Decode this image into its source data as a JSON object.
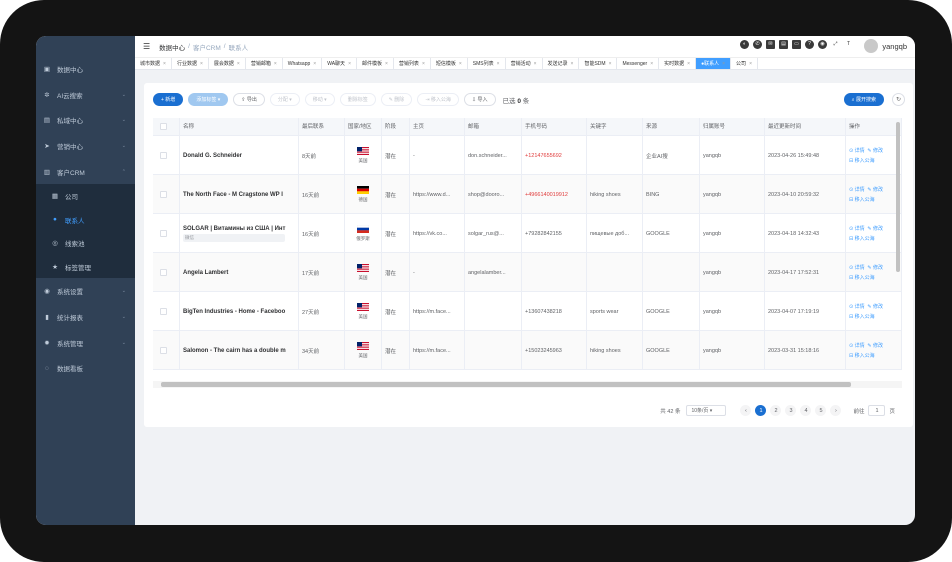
{
  "breadcrumb": [
    "数据中心",
    "客户CRM",
    "联系人"
  ],
  "user": {
    "name": "yangqb"
  },
  "sidebar": {
    "items": [
      {
        "label": "数据中心",
        "icon": "monitor-icon",
        "glyph": "▣"
      },
      {
        "label": "AI云搜索",
        "icon": "gear-icon",
        "glyph": "✲"
      },
      {
        "label": "私域中心",
        "icon": "database-icon",
        "glyph": "▤"
      },
      {
        "label": "营销中心",
        "icon": "send-icon",
        "glyph": "➤"
      },
      {
        "label": "客户CRM",
        "icon": "building-icon",
        "glyph": "▥"
      }
    ],
    "sub": [
      {
        "label": "公司",
        "icon": "company-icon",
        "glyph": "▦"
      },
      {
        "label": "联系人",
        "icon": "user-icon",
        "glyph": "●"
      },
      {
        "label": "线索池",
        "icon": "clue-icon",
        "glyph": "◎"
      },
      {
        "label": "标签管理",
        "icon": "star-icon",
        "glyph": "★"
      }
    ],
    "items2": [
      {
        "label": "系统设置",
        "icon": "globe-icon",
        "glyph": "◉"
      },
      {
        "label": "统计报表",
        "icon": "chart-icon",
        "glyph": "▮"
      },
      {
        "label": "系统管理",
        "icon": "cog-icon",
        "glyph": "✹"
      },
      {
        "label": "数据看板",
        "icon": "dashboard-icon",
        "glyph": "◌"
      }
    ]
  },
  "tabs": [
    "城市数据",
    "行业数据",
    "展会数据",
    "营销邮箱",
    "Whatsapp",
    "WA聊天",
    "邮件模板",
    "营销列表",
    "短信模板",
    "SMS列表",
    "营销活动",
    "发送记录",
    "智能SDM",
    "Messenger",
    "实时数据",
    "联系人",
    "公司"
  ],
  "toolbar": {
    "add": "+ 新增",
    "tag": "添加标签",
    "export": "导出",
    "assign": "分配",
    "move": "移动",
    "remove_tag": "删除标签",
    "delete": "删除",
    "move_pool": "移入公海",
    "import": "导入",
    "selected_prefix": "已选",
    "selected_count": "0",
    "selected_suffix": "条",
    "expand": "展开搜索"
  },
  "columns": [
    "名称",
    "最后联系",
    "国家/地区",
    "阶段",
    "主页",
    "邮箱",
    "手机号码",
    "关键字",
    "来源",
    "归属账号",
    "最近更新时间",
    "操作"
  ],
  "rows": [
    {
      "name": "Donald G. Schneider",
      "tag": "",
      "last": "8天前",
      "country": "美国",
      "flag": "us",
      "stage": "潜在",
      "home": "-",
      "email": "don.schneider...",
      "phone": "+12147655692",
      "phone_red": true,
      "keyword": "",
      "source": "企业AI搜",
      "owner": "yangqb",
      "updated": "2023-04-26 15:49:48"
    },
    {
      "name": "The North Face - M Cragstone WP I",
      "tag": "",
      "last": "16天前",
      "country": "德国",
      "flag": "de",
      "stage": "潜在",
      "home": "https://www.d...",
      "email": "shop@dooro...",
      "phone": "+4966140019912",
      "phone_red": true,
      "keyword": "hiking shoes",
      "source": "BING",
      "owner": "yangqb",
      "updated": "2023-04-10 20:59:32"
    },
    {
      "name": "SOLGAR | Витамины из США | Инт",
      "tag": "微信",
      "last": "16天前",
      "country": "俄罗斯",
      "flag": "ru",
      "stage": "潜在",
      "home": "https://vk.co...",
      "email": "solgar_rus@...",
      "phone": "+79282842155",
      "phone_red": false,
      "keyword": "пищевые доб...",
      "source": "GOOGLE",
      "owner": "yangqb",
      "updated": "2023-04-18 14:32:43"
    },
    {
      "name": "Angela Lambert",
      "tag": "",
      "last": "17天前",
      "country": "美国",
      "flag": "us",
      "stage": "潜在",
      "home": "-",
      "email": "angelalamber...",
      "phone": "",
      "phone_red": false,
      "keyword": "",
      "source": "",
      "owner": "yangqb",
      "updated": "2023-04-17 17:52:31"
    },
    {
      "name": "BigTen Industries - Home - Faceboo",
      "tag": "",
      "last": "27天前",
      "country": "美国",
      "flag": "us",
      "stage": "潜在",
      "home": "https://m.face...",
      "email": "",
      "phone": "+13607438218",
      "phone_red": false,
      "keyword": "sports wear",
      "source": "GOOGLE",
      "owner": "yangqb",
      "updated": "2023-04-07 17:19:19"
    },
    {
      "name": "Salomon - The cairn has a double m",
      "tag": "",
      "last": "34天前",
      "country": "美国",
      "flag": "us",
      "stage": "潜在",
      "home": "https://m.face...",
      "email": "",
      "phone": "+15023245963",
      "phone_red": false,
      "keyword": "hiking shoes",
      "source": "GOOGLE",
      "owner": "yangqb",
      "updated": "2023-03-31 15:18:16"
    }
  ],
  "ops": {
    "detail": "详情",
    "edit": "修改",
    "move_pool": "移入公海"
  },
  "pagination": {
    "total": "共 42 条",
    "size": "10条/页",
    "pages": [
      "1",
      "2",
      "3",
      "4",
      "5"
    ],
    "current": "1",
    "goto": "前往",
    "goto_value": "1",
    "goto_suffix": "页"
  },
  "colors": {
    "sidebar": "#304156",
    "accent": "#1a6fd1",
    "active_text": "#409eff"
  }
}
